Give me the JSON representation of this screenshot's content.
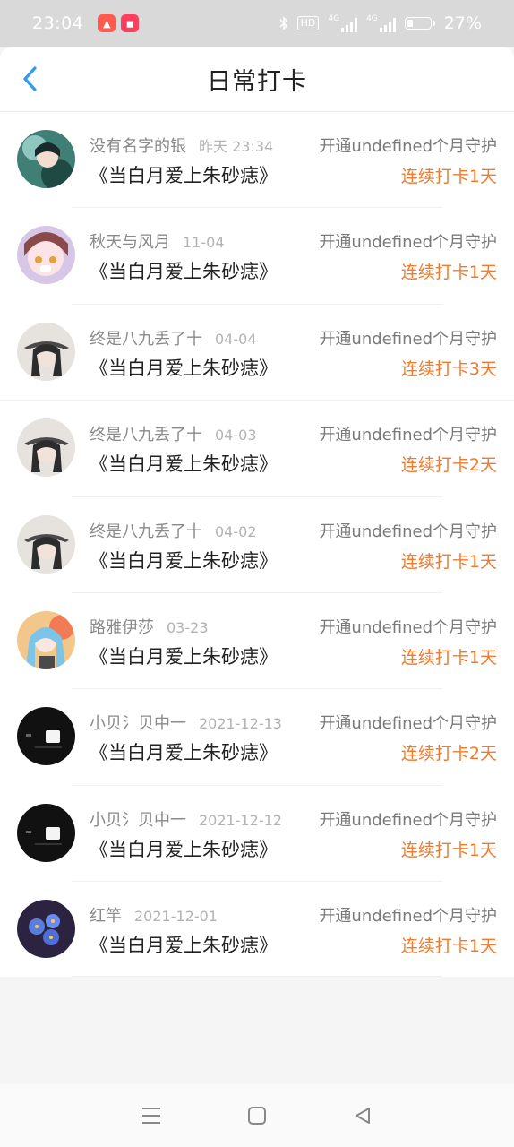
{
  "status_bar": {
    "time": "23:04",
    "hd_label": "HD",
    "net1": "4G",
    "net2": "4G",
    "battery_percent": "27%",
    "battery_level": 0.27
  },
  "header": {
    "title": "日常打卡",
    "back_icon": "chevron-left-icon",
    "accent_color": "#2e9bf0"
  },
  "records": [
    {
      "name": "没有名字的银",
      "time": "昨天 23:34",
      "book": "《当白月爱上朱砂痣》",
      "guard": "开通undefined个月守护",
      "streak": "连续打卡1天"
    },
    {
      "name": "秋天与风月",
      "time": "11-04",
      "book": "《当白月爱上朱砂痣》",
      "guard": "开通undefined个月守护",
      "streak": "连续打卡1天"
    },
    {
      "name": "终是八九丢了十",
      "time": "04-04",
      "book": "《当白月爱上朱砂痣》",
      "guard": "开通undefined个月守护",
      "streak": "连续打卡3天"
    },
    {
      "name": "终是八九丢了十",
      "time": "04-03",
      "book": "《当白月爱上朱砂痣》",
      "guard": "开通undefined个月守护",
      "streak": "连续打卡2天"
    },
    {
      "name": "终是八九丢了十",
      "time": "04-02",
      "book": "《当白月爱上朱砂痣》",
      "guard": "开通undefined个月守护",
      "streak": "连续打卡1天"
    },
    {
      "name": "路雅伊莎",
      "time": "03-23",
      "book": "《当白月爱上朱砂痣》",
      "guard": "开通undefined个月守护",
      "streak": "连续打卡1天"
    },
    {
      "name": "小贝氵贝中一",
      "time": "2021-12-13",
      "book": "《当白月爱上朱砂痣》",
      "guard": "开通undefined个月守护",
      "streak": "连续打卡2天"
    },
    {
      "name": "小贝氵贝中一",
      "time": "2021-12-12",
      "book": "《当白月爱上朱砂痣》",
      "guard": "开通undefined个月守护",
      "streak": "连续打卡1天"
    },
    {
      "name": "红竿",
      "time": "2021-12-01",
      "book": "《当白月爱上朱砂痣》",
      "guard": "开通undefined个月守护",
      "streak": "连续打卡1天"
    }
  ],
  "colors": {
    "streak": "#f07b2e",
    "status_bar_bg": "#d9d9d9"
  },
  "nav": {
    "menu_icon": "menu-icon",
    "home_icon": "square-home-icon",
    "back_icon": "triangle-back-icon"
  }
}
